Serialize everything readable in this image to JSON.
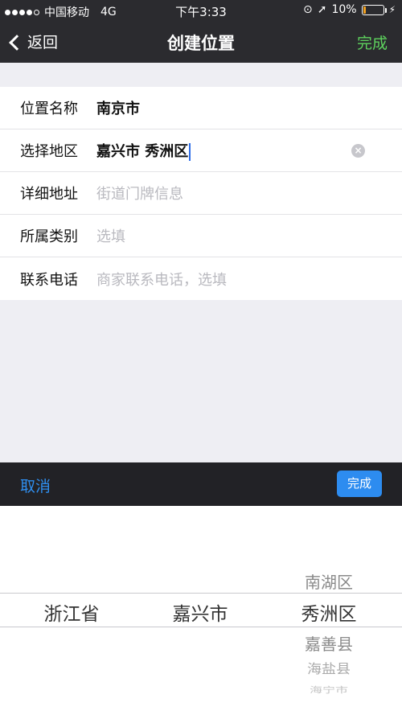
{
  "status_bar": {
    "carrier": "中国移动",
    "network": "4G",
    "time": "下午3:33",
    "battery": "10%"
  },
  "nav": {
    "back_label": "返回",
    "title": "创建位置",
    "done_label": "完成"
  },
  "form": {
    "rows": [
      {
        "label": "位置名称",
        "value": "南京市"
      },
      {
        "label": "选择地区",
        "value": "嘉兴市 秀洲区"
      },
      {
        "label": "详细地址",
        "placeholder": "街道门牌信息"
      },
      {
        "label": "所属类别",
        "placeholder": "选填"
      },
      {
        "label": "联系电话",
        "placeholder": "商家联系电话，选填"
      }
    ]
  },
  "picker": {
    "cancel_label": "取消",
    "done_label": "完成",
    "province": {
      "selected": "浙江省"
    },
    "city": {
      "selected": "嘉兴市"
    },
    "district": {
      "above": [
        "南湖区"
      ],
      "selected": "秀洲区",
      "below": [
        "嘉善县",
        "海盐县",
        "海宁市"
      ]
    }
  }
}
